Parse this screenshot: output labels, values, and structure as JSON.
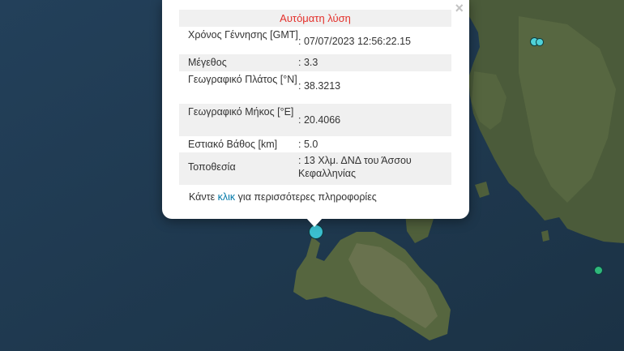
{
  "popup": {
    "title": "Αυτόματη λύση",
    "close_symbol": "×",
    "rows": [
      {
        "label": "Χρόνος Γέννησης [GMT]",
        "value": ": 07/07/2023 12:56:22.15"
      },
      {
        "label": "Μέγεθος",
        "value": ": 3.3"
      },
      {
        "label": "Γεωγραφικό Πλάτος [°N]",
        "value": ": 38.3213"
      },
      {
        "label": "Γεωγραφικό Μήκος [°E]",
        "value": ": 20.4066"
      },
      {
        "label": "Εστιακό Βάθος [km]",
        "value": ": 5.0"
      },
      {
        "label": "Τοποθεσία",
        "value": ": 13 Χλμ. ΔΝΔ του Άσσου Κεφαλληνίας"
      }
    ],
    "footer_before": "Κάντε ",
    "footer_link": "κλικ",
    "footer_after": " για περισσότερες πληροφορίες"
  },
  "colors": {
    "sea": "#1f3a4e",
    "land": "#4a5a38",
    "title": "#e4302b",
    "link": "#0078a8",
    "marker_selected": "#3bbfcf",
    "marker_green": "#2fb87a"
  },
  "markers": [
    {
      "name": "selected-quake-marker",
      "color": "#3bbfcf"
    },
    {
      "name": "quake-marker-north-a",
      "color": "#4fd1d9"
    },
    {
      "name": "quake-marker-north-b",
      "color": "#4fd1d9"
    },
    {
      "name": "quake-marker-east",
      "color": "#2fb87a"
    }
  ]
}
